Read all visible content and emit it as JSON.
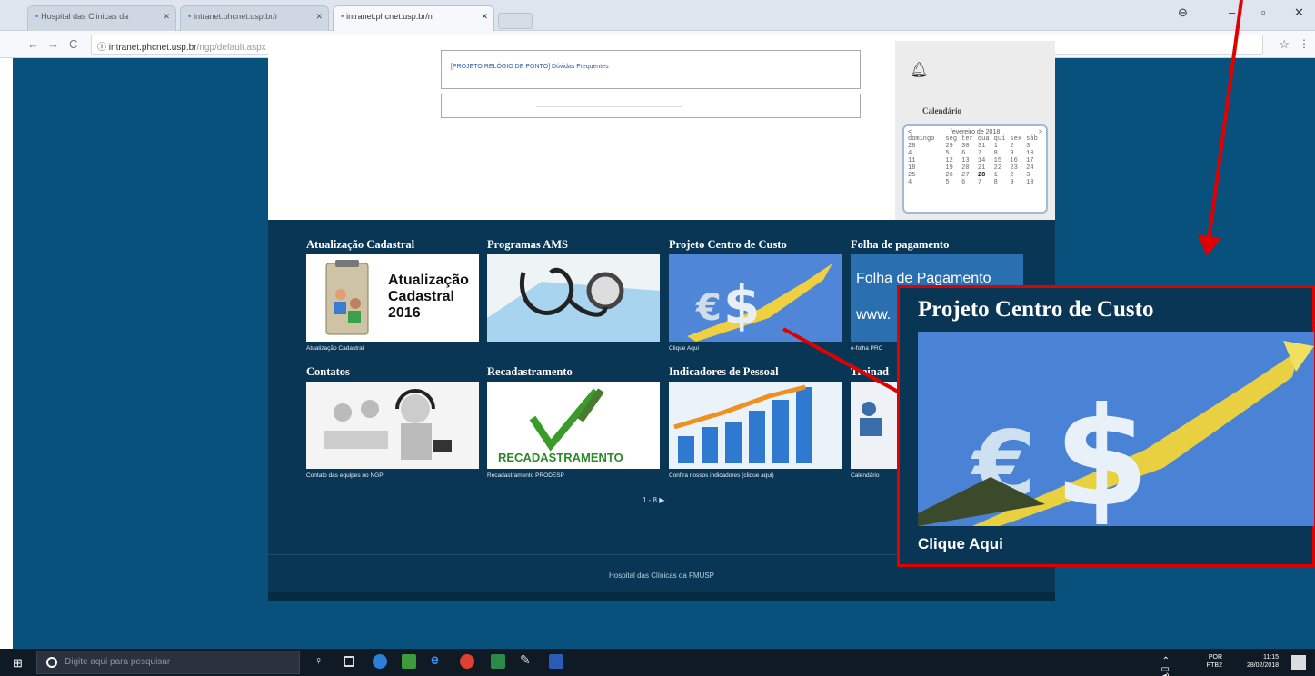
{
  "browser": {
    "tabs": [
      {
        "label": "Hospital das Clinicas da",
        "active": false
      },
      {
        "label": "intranet.phcnet.usp.br/r",
        "active": false
      },
      {
        "label": "intranet.phcnet.usp.br/n",
        "active": true
      }
    ],
    "url_host": "intranet.phcnet.usp.br",
    "url_path": "/ngp/default.aspx"
  },
  "top": {
    "link": "[PROJETO RELÓGIO DE PONTO] Dúvidas Frequentes",
    "calendar_title": "Calendário",
    "calendar": {
      "month": "fevereiro de 2018",
      "prev": "<",
      "next": ">",
      "days": [
        "domingo",
        "seg",
        "ter",
        "qua",
        "qui",
        "sex",
        "sáb"
      ],
      "weeks": [
        [
          "28",
          "29",
          "30",
          "31",
          "1",
          "2",
          "3"
        ],
        [
          "4",
          "5",
          "6",
          "7",
          "8",
          "9",
          "10"
        ],
        [
          "11",
          "12",
          "13",
          "14",
          "15",
          "16",
          "17"
        ],
        [
          "18",
          "19",
          "20",
          "21",
          "22",
          "23",
          "24"
        ],
        [
          "25",
          "26",
          "27",
          "28",
          "1",
          "2",
          "3"
        ],
        [
          "4",
          "5",
          "6",
          "7",
          "8",
          "9",
          "10"
        ]
      ]
    }
  },
  "tiles": [
    {
      "title": "Atualização Cadastral",
      "caption": "Atualização Cadastral",
      "image_text": [
        "Atualização",
        "Cadastral",
        "2016"
      ]
    },
    {
      "title": "Programas AMS",
      "caption": ""
    },
    {
      "title": "Projeto Centro de Custo",
      "caption": "Clique Aqui"
    },
    {
      "title": "Folha de pagamento",
      "caption": "e-folha PRC",
      "image_text": [
        "Folha de Pagamento",
        "www."
      ]
    },
    {
      "title": "Contatos",
      "caption": "Contato das equipes no NGP"
    },
    {
      "title": "Recadastramento",
      "caption": "Recadastramento PRODESP",
      "image_text": [
        "RECADASTRAMENTO"
      ]
    },
    {
      "title": "Indicadores de Pessoal",
      "caption": "Confira nossos indicadores (clique aqui)"
    },
    {
      "title": "Treinad",
      "caption": "Calendário"
    }
  ],
  "pager": "1 - 8 ▶",
  "footer": "Hospital das Clínicas da FMUSP",
  "zoom": {
    "title": "Projeto Centro de Custo",
    "caption": "Clique Aqui"
  },
  "taskbar": {
    "search_placeholder": "Digite aqui para pesquisar",
    "lang": "POR",
    "layout": "PTB2",
    "time": "11:15",
    "date": "28/02/2018"
  },
  "colors": {
    "page_bg": "#07517c",
    "panel": "#0a3656",
    "highlight": "#e00000"
  }
}
